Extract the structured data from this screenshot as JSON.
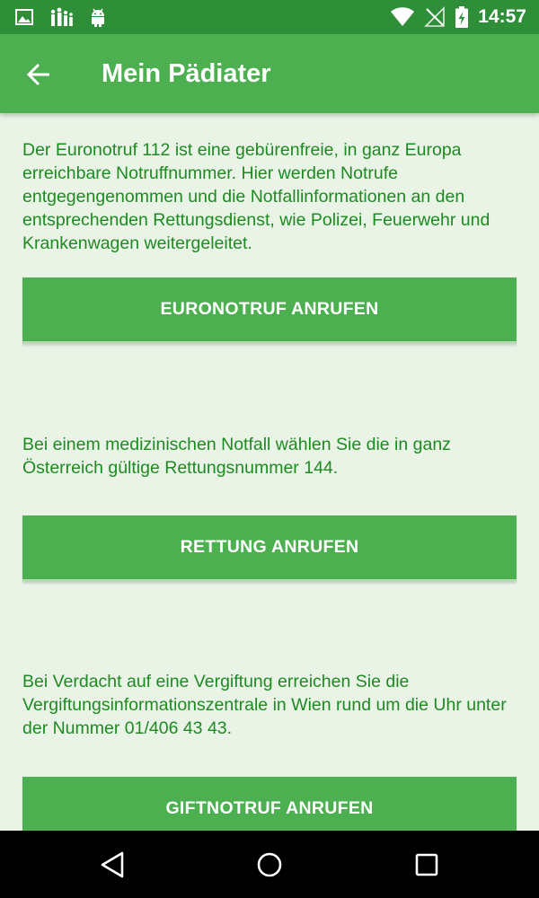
{
  "status_bar": {
    "time": "14:57",
    "left_icons": [
      "image-icon",
      "family-app-icon",
      "android-icon"
    ],
    "right_icons": [
      "wifi-icon",
      "cellular-no-signal-icon",
      "battery-charging-icon"
    ]
  },
  "app_bar": {
    "title": "Mein Pädiater",
    "back_icon": "arrow-back-icon"
  },
  "sections": [
    {
      "text": "Der Euronotruf 112 ist eine gebürenfreie, in ganz Europa erreichbare Notruffnummer. Hier werden Notrufe entgegengenommen und die Notfallinformationen an den entsprechenden Rettungsdienst, wie Polizei, Feuerwehr und Krankenwagen weitergeleitet.",
      "button_label": "EURONOTRUF ANRUFEN"
    },
    {
      "text": "Bei einem medizinischen Notfall wählen Sie die in ganz Österreich gültige Rettungsnummer 144.",
      "button_label": "RETTUNG ANRUFEN"
    },
    {
      "text": "Bei Verdacht auf eine Vergiftung erreichen Sie die Vergiftungsinformationszentrale in Wien rund um die Uhr unter der Nummer 01/406 43 43.",
      "button_label": "GIFTNOTRUF ANRUFEN"
    }
  ],
  "colors": {
    "status_bar": "#2f8f38",
    "app_bar": "#4caf50",
    "background": "#e9f3e6",
    "text": "#1e8a22",
    "button": "#4caf50",
    "nav_bar": "#000000"
  },
  "nav_bar": {
    "icons": [
      "nav-back-icon",
      "nav-home-icon",
      "nav-recents-icon"
    ]
  }
}
